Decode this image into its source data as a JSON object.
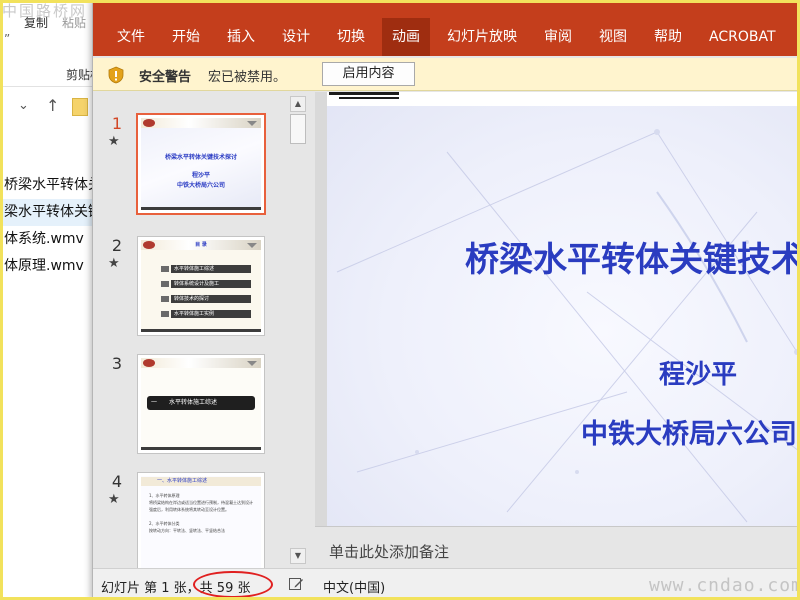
{
  "explorer": {
    "site_mark": "中国路桥网",
    "copy_label": "复制",
    "paste_label": "粘贴",
    "quote_mark": "”",
    "clipboard_label": "剪贴板",
    "files": [
      {
        "name": "桥梁水平转体关键技术.ppt",
        "state": "normal"
      },
      {
        "name": "梁水平转体关键技术研讨.ppt",
        "state": "selected"
      },
      {
        "name": "体系统.wmv",
        "state": "normal"
      },
      {
        "name": "体原理.wmv",
        "state": "normal"
      }
    ]
  },
  "ribbon": {
    "tabs": [
      {
        "label": "文件",
        "active": false
      },
      {
        "label": "开始",
        "active": false
      },
      {
        "label": "插入",
        "active": false
      },
      {
        "label": "设计",
        "active": false
      },
      {
        "label": "切换",
        "active": false
      },
      {
        "label": "动画",
        "active": true
      },
      {
        "label": "幻灯片放映",
        "active": false
      },
      {
        "label": "审阅",
        "active": false
      },
      {
        "label": "视图",
        "active": false
      },
      {
        "label": "帮助",
        "active": false
      },
      {
        "label": "ACROBAT",
        "active": false
      }
    ],
    "accent_color": "#c43e1c"
  },
  "security_bar": {
    "title": "安全警告",
    "message": "宏已被禁用。",
    "button_label": "启用内容"
  },
  "thumbnails": [
    {
      "number": "1",
      "selected": true,
      "has_animation_star": true,
      "title": "桥梁水平转体关键技术探讨",
      "author": "程沙平",
      "org": "中铁大桥局六公司"
    },
    {
      "number": "2",
      "selected": false,
      "has_animation_star": true,
      "heading": "目  录",
      "items": [
        "水平转体施工综述",
        "转体系统设计及施工",
        "转体技术的探讨",
        "水平转体施工实例"
      ]
    },
    {
      "number": "3",
      "selected": false,
      "has_animation_star": false,
      "section_num": "一",
      "section_title": "水平转体施工综述"
    },
    {
      "number": "4",
      "selected": false,
      "has_animation_star": true,
      "heading": "一、水平转体施工综述",
      "body": [
        "1、水平转体原理",
        "将桥梁结构在岸边或适当位置进行预制，待混凝土达到设计强度后，利用转体系统将其转动至设计位置。",
        "2、水平转体分类",
        "按转动方向：平转法、竖转法、平竖结合法"
      ]
    }
  ],
  "slide": {
    "title": "桥梁水平转体关键技术探讨",
    "author": "程沙平",
    "org": "中铁大桥局六公司"
  },
  "notes": {
    "placeholder": "单击此处添加备注"
  },
  "status_bar": {
    "slide_info": "幻灯片 第 1 张，共 59 张",
    "language": "中文(中国)"
  },
  "watermark": "www.cndao.com",
  "colors": {
    "slide_text": "#2a3cc0",
    "selection_border": "#e8603c",
    "highlight_ellipse": "#e02020"
  }
}
